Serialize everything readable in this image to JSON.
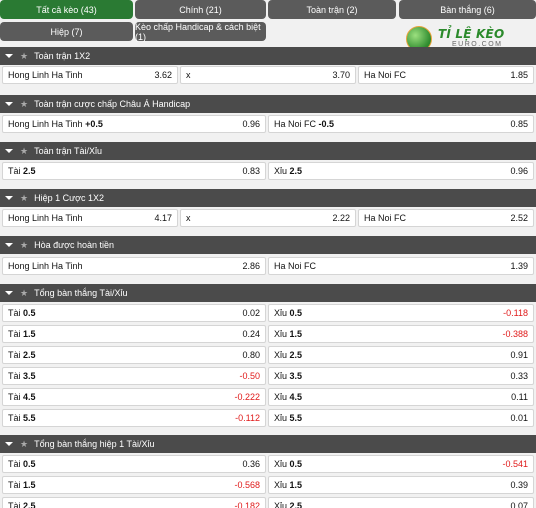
{
  "tabs": [
    {
      "label": "Tất cả kèo (43)"
    },
    {
      "label": "Chính (21)"
    },
    {
      "label": "Toàn trận (2)"
    },
    {
      "label": "Bàn thắng (6)"
    },
    {
      "label": "Hiệp (7)"
    },
    {
      "label": "Kèo chấp Handicap & cách biệt (1)"
    }
  ],
  "logo": {
    "brand": "TỈ LỆ KÈO",
    "sub": "EURO.COM"
  },
  "colors": {
    "active_tab": "#2a7a33",
    "tab": "#5b5b5b",
    "header": "#4b4b4b",
    "negative": "#e01a1a"
  },
  "sections": {
    "s1": {
      "title": "Toàn trận 1X2",
      "home": "Hong Linh Ha Tinh",
      "home_odds": "3.62",
      "draw": "x",
      "draw_odds": "3.70",
      "away": "Ha Noi FC",
      "away_odds": "1.85"
    },
    "s2": {
      "title": "Toàn trận cược chấp Châu Á Handicap",
      "home": "Hong Linh Ha Tinh",
      "home_line": "+0.5",
      "home_odds": "0.96",
      "away": "Ha Noi FC",
      "away_line": "-0.5",
      "away_odds": "0.85"
    },
    "s3": {
      "title": "Toàn trận Tài/Xỉu",
      "over": "Tài",
      "over_line": "2.5",
      "over_odds": "0.83",
      "under": "Xỉu",
      "under_line": "2.5",
      "under_odds": "0.96"
    },
    "s4": {
      "title": "Hiệp 1 Cược 1X2",
      "home": "Hong Linh Ha Tinh",
      "home_odds": "4.17",
      "draw": "x",
      "draw_odds": "2.22",
      "away": "Ha Noi FC",
      "away_odds": "2.52"
    },
    "s5": {
      "title": "Hòa được hoàn tiền",
      "home": "Hong Linh Ha Tinh",
      "home_odds": "2.86",
      "away": "Ha Noi FC",
      "away_odds": "1.39"
    },
    "s6": {
      "title": "Tổng bàn thắng Tài/Xỉu",
      "rows": [
        {
          "over": "Tài",
          "line": "0.5",
          "over_odds": "0.02",
          "under": "Xỉu",
          "under_odds": "-0.118"
        },
        {
          "over": "Tài",
          "line": "1.5",
          "over_odds": "0.24",
          "under": "Xỉu",
          "under_odds": "-0.388"
        },
        {
          "over": "Tài",
          "line": "2.5",
          "over_odds": "0.80",
          "under": "Xỉu",
          "under_odds": "0.91"
        },
        {
          "over": "Tài",
          "line": "3.5",
          "over_odds": "-0.50",
          "under": "Xỉu",
          "under_odds": "0.33"
        },
        {
          "over": "Tài",
          "line": "4.5",
          "over_odds": "-0.222",
          "under": "Xỉu",
          "under_odds": "0.11"
        },
        {
          "over": "Tài",
          "line": "5.5",
          "over_odds": "-0.112",
          "under": "Xỉu",
          "under_odds": "0.01"
        }
      ]
    },
    "s7": {
      "title": "Tổng bàn thắng hiệp 1 Tài/Xỉu",
      "rows": [
        {
          "over": "Tài",
          "line": "0.5",
          "over_odds": "0.36",
          "under": "Xỉu",
          "under_odds": "-0.541"
        },
        {
          "over": "Tài",
          "line": "1.5",
          "over_odds": "-0.568",
          "under": "Xỉu",
          "under_odds": "0.39"
        },
        {
          "over": "Tài",
          "line": "2.5",
          "over_odds": "-0.182",
          "under": "Xỉu",
          "under_odds": "0.07"
        }
      ]
    }
  }
}
